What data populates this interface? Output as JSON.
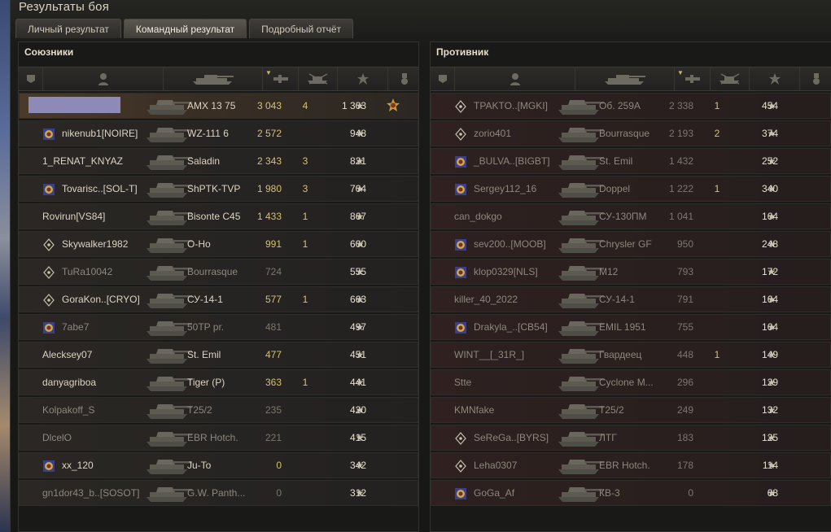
{
  "window": {
    "title": "Результаты боя"
  },
  "tabs": [
    {
      "label": "Личный результат",
      "active": false
    },
    {
      "label": "Командный результат",
      "active": true
    },
    {
      "label": "Подробный отчёт",
      "active": false
    }
  ],
  "columns": [
    "platoon-icon",
    "player-icon",
    "tank-icon",
    "damage-icon",
    "kills-icon",
    "xp-star-icon",
    "medal-icon"
  ],
  "allies": {
    "title": "Союзники",
    "rows": [
      {
        "player": "",
        "vehicle": "AMX 13 75",
        "damage": "3 043",
        "kills": "4",
        "xp": "1 303",
        "me": true,
        "medal": true,
        "icon": "none",
        "dim": false
      },
      {
        "player": "nikenub1[NOIRE]",
        "vehicle": "WZ-111 6",
        "damage": "2 572",
        "kills": "",
        "xp": "948",
        "icon": "clan",
        "dim": false
      },
      {
        "player": "1_RENAT_KNYAZ",
        "vehicle": "Saladin",
        "damage": "2 343",
        "kills": "3",
        "xp": "821",
        "icon": "none",
        "dim": false
      },
      {
        "player": "Tovarisc..[SOL-T]",
        "vehicle": "ShPTK-TVP",
        "damage": "1 980",
        "kills": "3",
        "xp": "704",
        "icon": "clan",
        "dim": false
      },
      {
        "player": "Rovirun[VS84]",
        "vehicle": "Bisonte C45",
        "damage": "1 433",
        "kills": "1",
        "xp": "867",
        "icon": "none",
        "dim": false
      },
      {
        "player": "Skywalker1982",
        "vehicle": "O-Ho",
        "damage": "991",
        "kills": "1",
        "xp": "600",
        "icon": "diamond",
        "dim": false
      },
      {
        "player": "TuRa10042",
        "vehicle": "Bourrasque",
        "damage": "724",
        "kills": "",
        "xp": "555",
        "icon": "diamond",
        "dim": true
      },
      {
        "player": "GoraKon..[CRYO]",
        "vehicle": "СУ-14-1",
        "damage": "577",
        "kills": "1",
        "xp": "663",
        "icon": "diamond",
        "dim": false
      },
      {
        "player": "7abe7",
        "vehicle": "50TP pr.",
        "damage": "481",
        "kills": "",
        "xp": "497",
        "icon": "clan",
        "dim": true
      },
      {
        "player": "Alecksey07",
        "vehicle": "St. Emil",
        "damage": "477",
        "kills": "",
        "xp": "451",
        "icon": "none",
        "dim": false
      },
      {
        "player": "danyagriboa",
        "vehicle": "Tiger (P)",
        "damage": "363",
        "kills": "1",
        "xp": "441",
        "icon": "none",
        "dim": false
      },
      {
        "player": "Kolpakoff_S",
        "vehicle": "T25/2",
        "damage": "235",
        "kills": "",
        "xp": "420",
        "icon": "none",
        "dim": true
      },
      {
        "player": "DlcelO",
        "vehicle": "EBR Hotch.",
        "damage": "221",
        "kills": "",
        "xp": "415",
        "icon": "none",
        "dim": true
      },
      {
        "player": "xx_120",
        "vehicle": "Ju-To",
        "damage": "0",
        "kills": "",
        "xp": "342",
        "icon": "clan",
        "dim": false
      },
      {
        "player": "gn1dor43_b..[SOSOT]",
        "vehicle": "G.W. Panth...",
        "damage": "0",
        "kills": "",
        "xp": "312",
        "icon": "none",
        "dim": true
      }
    ]
  },
  "enemies": {
    "title": "Противник",
    "rows": [
      {
        "player": "TPAKTO..[MGKI]",
        "vehicle": "Об. 259А",
        "damage": "2 338",
        "kills": "1",
        "xp": "454",
        "icon": "diamond",
        "dim": true
      },
      {
        "player": "zorio401",
        "vehicle": "Bourrasque",
        "damage": "2 193",
        "kills": "2",
        "xp": "374",
        "icon": "diamond",
        "dim": true
      },
      {
        "player": "_BULVA..[BIGBT]",
        "vehicle": "St. Emil",
        "damage": "1 432",
        "kills": "",
        "xp": "252",
        "icon": "clan",
        "dim": true
      },
      {
        "player": "Sergey112_16",
        "vehicle": "Doppel",
        "damage": "1 222",
        "kills": "1",
        "xp": "340",
        "icon": "clan",
        "dim": true
      },
      {
        "player": "can_dokgo",
        "vehicle": "СУ-130ПМ",
        "damage": "1 041",
        "kills": "",
        "xp": "164",
        "icon": "none",
        "dim": true
      },
      {
        "player": "sev200..[MOOB]",
        "vehicle": "Chrysler GF",
        "damage": "950",
        "kills": "",
        "xp": "248",
        "icon": "clan",
        "dim": true
      },
      {
        "player": "klop0329[NLS]",
        "vehicle": "M12",
        "damage": "793",
        "kills": "",
        "xp": "172",
        "icon": "clan",
        "dim": true
      },
      {
        "player": "killer_40_2022",
        "vehicle": "СУ-14-1",
        "damage": "791",
        "kills": "",
        "xp": "164",
        "icon": "none",
        "dim": true
      },
      {
        "player": "Drakyla_..[CB54]",
        "vehicle": "EMIL 1951",
        "damage": "755",
        "kills": "",
        "xp": "164",
        "icon": "clan",
        "dim": true
      },
      {
        "player": "WINT__[_31R_]",
        "vehicle": "Гвардеец",
        "damage": "448",
        "kills": "1",
        "xp": "149",
        "icon": "none",
        "dim": true
      },
      {
        "player": "Stte",
        "vehicle": "Cyclone M...",
        "damage": "296",
        "kills": "",
        "xp": "129",
        "icon": "none",
        "dim": true
      },
      {
        "player": "KMNfake",
        "vehicle": "T25/2",
        "damage": "249",
        "kills": "",
        "xp": "132",
        "icon": "none",
        "dim": true
      },
      {
        "player": "SeReGa..[BYRS]",
        "vehicle": "ЛТГ",
        "damage": "183",
        "kills": "",
        "xp": "125",
        "icon": "diamond",
        "dim": true
      },
      {
        "player": "Leha0307",
        "vehicle": "EBR Hotch.",
        "damage": "178",
        "kills": "",
        "xp": "114",
        "icon": "diamond",
        "dim": true
      },
      {
        "player": "GoGa_Af",
        "vehicle": "КВ-3",
        "damage": "0",
        "kills": "",
        "xp": "68",
        "icon": "clan",
        "dim": true
      }
    ]
  },
  "star_glyph": "★",
  "colors": {
    "accent": "#d7c06d",
    "highlight_row": "#4a3a2a",
    "enemy_row": "#2e2120"
  }
}
